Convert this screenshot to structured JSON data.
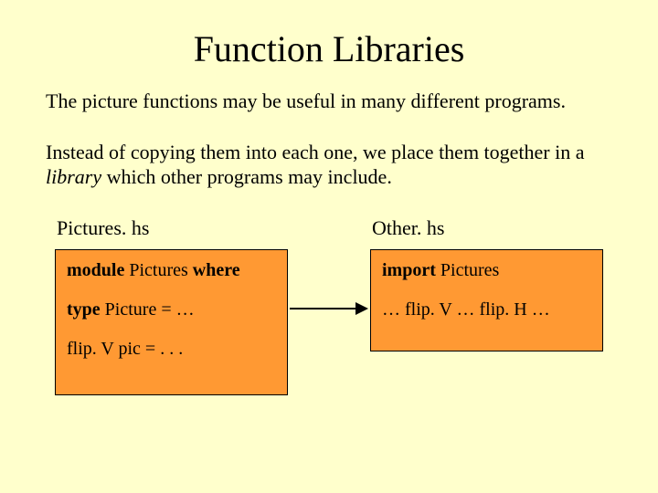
{
  "title": "Function Libraries",
  "para1": "The picture functions may be useful in many different programs.",
  "para2_a": "Instead of copying them into each one, we place them together in a ",
  "para2_em": "library",
  "para2_b": " which other programs may include.",
  "left": {
    "label": "Pictures. hs",
    "l1_kw1": "module",
    "l1_mid": " Pictures ",
    "l1_kw2": "where",
    "l2_kw": "type",
    "l2_rest": " Picture = …",
    "l3": "flip. V pic = . . ."
  },
  "right": {
    "label": "Other. hs",
    "l1_kw": "import",
    "l1_rest": " Pictures",
    "l2": "… flip. V … flip. H …"
  }
}
